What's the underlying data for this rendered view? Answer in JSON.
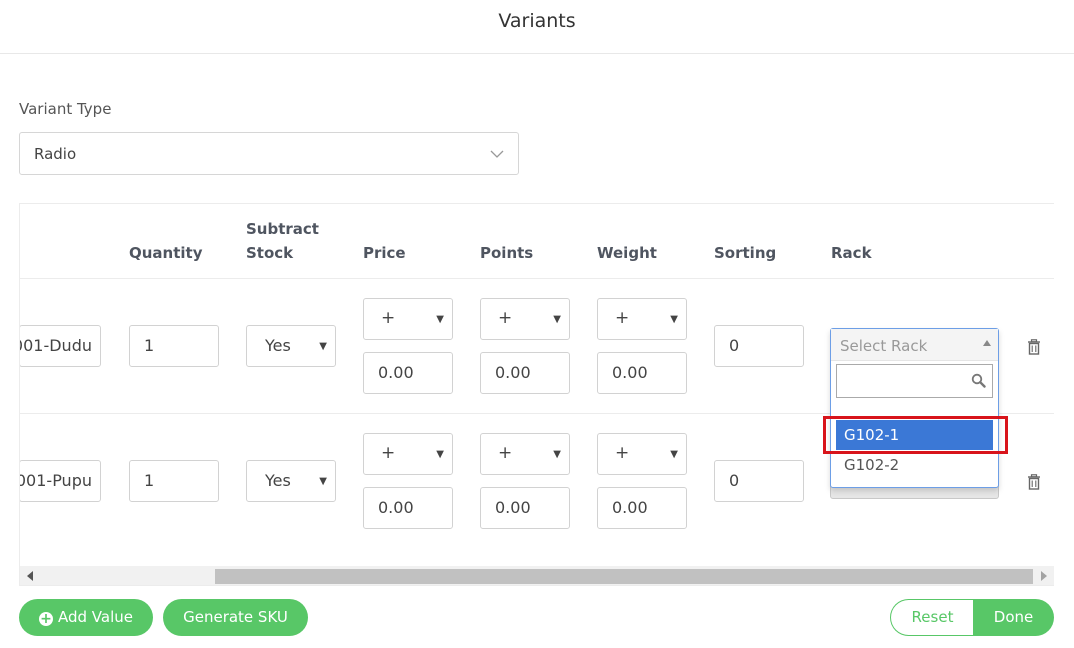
{
  "header": {
    "title": "Variants"
  },
  "variant_type": {
    "label": "Variant Type",
    "value": "Radio"
  },
  "table": {
    "headers": {
      "quantity": "Quantity",
      "subtract_stock_1": "Subtract",
      "subtract_stock_2": "Stock",
      "price": "Price",
      "points": "Points",
      "weight": "Weight",
      "sorting": "Sorting",
      "rack": "Rack"
    },
    "rows": [
      {
        "sku": "001-Dudu",
        "quantity": "1",
        "subtract_stock": "Yes",
        "price_sign": "+",
        "price": "0.00",
        "points_sign": "+",
        "points": "0.00",
        "weight_sign": "+",
        "weight": "0.00",
        "sorting": "0"
      },
      {
        "sku": "001-Pupu",
        "quantity": "1",
        "subtract_stock": "Yes",
        "price_sign": "+",
        "price": "0.00",
        "points_sign": "+",
        "points": "0.00",
        "weight_sign": "+",
        "weight": "0.00",
        "sorting": "0"
      }
    ]
  },
  "rack_dropdown": {
    "placeholder": "Select Rack",
    "search_value": "",
    "options": [
      "G102-1",
      "G102-2"
    ]
  },
  "buttons": {
    "add_value": "Add Value",
    "generate_sku": "Generate SKU",
    "reset": "Reset",
    "done": "Done"
  },
  "colors": {
    "accent_green": "#58c767",
    "selected_blue": "#3b78d6",
    "highlight_red": "#d8141b"
  }
}
